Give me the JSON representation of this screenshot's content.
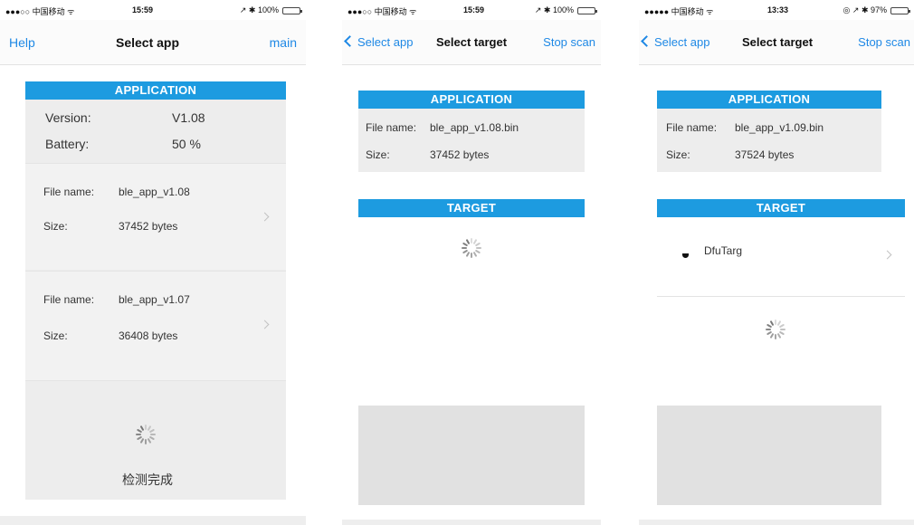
{
  "screens": [
    {
      "status": {
        "signal": "●●●○○ 中国移动 ᯤ",
        "time": "15:59",
        "right": "↗ ✱ 100%",
        "battery_level": 1.0
      },
      "nav": {
        "left": "Help",
        "title": "Select app",
        "right": "main"
      },
      "application": {
        "header": "APPLICATION",
        "version_label": "Version:",
        "version_value": "V1.08",
        "battery_label": "Battery:",
        "battery_value": "50 %",
        "files": [
          {
            "name_label": "File name:",
            "name_value": "ble_app_v1.08",
            "size_label": "Size:",
            "size_value": "37452 bytes"
          },
          {
            "name_label": "File name:",
            "name_value": "ble_app_v1.07",
            "size_label": "Size:",
            "size_value": "36408 bytes"
          }
        ]
      },
      "status_text": "检测完成"
    },
    {
      "status": {
        "signal": "●●●○○ 中国移动 ᯤ",
        "time": "15:59",
        "right": "↗ ✱ 100%",
        "battery_level": 1.0
      },
      "nav": {
        "left": "Select app",
        "title": "Select target",
        "right": "Stop scan"
      },
      "application": {
        "header": "APPLICATION",
        "name_label": "File name:",
        "name_value": "ble_app_v1.08.bin",
        "size_label": "Size:",
        "size_value": "37452 bytes"
      },
      "target": {
        "header": "TARGET"
      }
    },
    {
      "status": {
        "signal": "●●●●● 中国移动 ᯤ",
        "time": "13:33",
        "right": "◎ ↗ ✱ 97%",
        "battery_level": 0.97
      },
      "nav": {
        "left": "Select app",
        "title": "Select target",
        "right": "Stop scan"
      },
      "application": {
        "header": "APPLICATION",
        "name_label": "File name:",
        "name_value": "ble_app_v1.09.bin",
        "size_label": "Size:",
        "size_value": "37524 bytes"
      },
      "target": {
        "header": "TARGET",
        "devices": [
          {
            "name": "DfuTarg"
          }
        ]
      }
    }
  ],
  "colors": {
    "accent": "#1e88e5",
    "header_bg": "#1d9be0",
    "panel_bg": "#ededed",
    "battery": "#4cd964"
  },
  "icons": {
    "back": "chevron-left-icon",
    "disclosure": "chevron-right-icon",
    "loading": "spinner-icon",
    "device": "bluetooth-device-icon"
  }
}
